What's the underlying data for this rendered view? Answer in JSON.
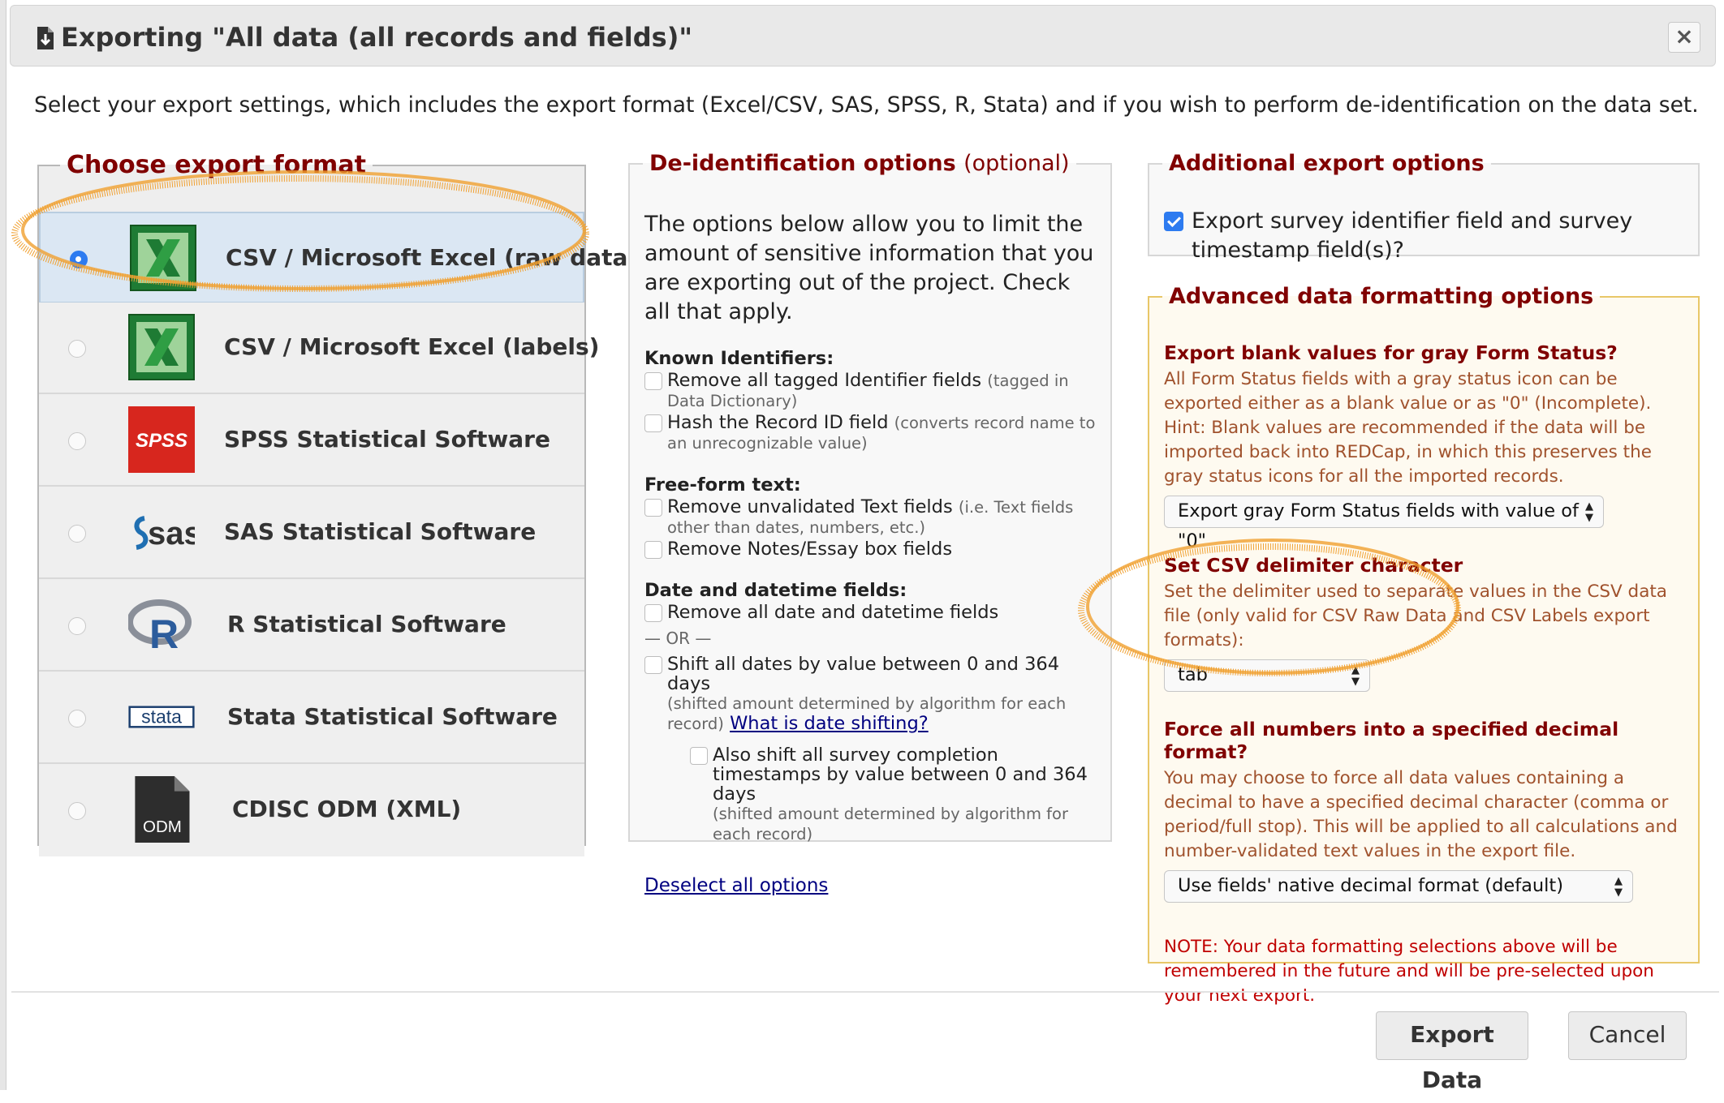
{
  "dialog": {
    "title": "Exporting \"All data (all records and fields)\"",
    "close_label": "×",
    "intro": "Select your export settings, which includes the export format (Excel/CSV, SAS, SPSS, R, Stata) and if you wish to perform de-identification on the data set."
  },
  "format_panel": {
    "legend": "Choose export format",
    "selected_index": 0,
    "formats": [
      {
        "label": "CSV / Microsoft Excel (raw data)",
        "icon": "excel-icon"
      },
      {
        "label": "CSV / Microsoft Excel (labels)",
        "icon": "excel-icon"
      },
      {
        "label": "SPSS Statistical Software",
        "icon": "spss-icon"
      },
      {
        "label": "SAS Statistical Software",
        "icon": "sas-icon"
      },
      {
        "label": "R Statistical Software",
        "icon": "r-icon"
      },
      {
        "label": "Stata Statistical Software",
        "icon": "stata-icon"
      },
      {
        "label": "CDISC ODM (XML)",
        "icon": "odm-file-icon"
      }
    ],
    "icon_text": {
      "spss": "SPSS",
      "sas": "sas",
      "r": "R",
      "stata": "stata",
      "odm": "ODM"
    }
  },
  "deid": {
    "legend": "De-identification options",
    "legend_optional": "(optional)",
    "description": "The options below allow you to limit the amount of sensitive information that you are exporting out of the project. Check all that apply.",
    "known_title": "Known Identifiers:",
    "remove_tagged": "Remove all tagged Identifier fields",
    "remove_tagged_note": "(tagged in Data Dictionary)",
    "hash_record": "Hash the Record ID field",
    "hash_record_note": "(converts record name to an unrecognizable value)",
    "freeform_title": "Free-form text:",
    "remove_text": "Remove unvalidated Text fields",
    "remove_text_note": "(i.e. Text fields other than dates, numbers, etc.)",
    "remove_notes": "Remove Notes/Essay box fields",
    "date_title": "Date and datetime fields:",
    "remove_dates": "Remove all date and datetime fields",
    "or_label": "— OR —",
    "shift_dates": "Shift all dates by value between 0 and 364 days",
    "shift_dates_note": "(shifted amount determined by algorithm for each record)",
    "date_shift_link": "What is date shifting?",
    "shift_survey": "Also shift all survey completion timestamps by value between 0 and 364 days",
    "shift_survey_note": "(shifted amount determined by algorithm for each record)",
    "deselect_link": "Deselect all options"
  },
  "additional": {
    "legend": "Additional export options",
    "survey_fields_label": "Export survey identifier field and survey timestamp field(s)?",
    "survey_fields_checked": true
  },
  "advanced": {
    "legend": "Advanced data formatting options",
    "blank_title": "Export blank values for gray Form Status?",
    "blank_desc": "All Form Status fields with a gray status icon can be exported either as a blank value or as \"0\" (Incomplete). Hint: Blank values are recommended if the data will be imported back into REDCap, in which this preserves the gray status icons for all the imported records.",
    "blank_select": "Export gray Form Status fields with value of \"0\"",
    "delim_title": "Set CSV delimiter character",
    "delim_desc": "Set the delimiter used to separate values in the CSV data file (only valid for CSV Raw Data and CSV Labels export formats):",
    "delim_select": "tab",
    "decimal_title": "Force all numbers into a specified decimal format?",
    "decimal_desc": "You may choose to force all data values containing a decimal to have a specified decimal character (comma or period/full stop). This will be applied to all calculations and number-validated text values in the export file.",
    "decimal_select": "Use fields' native decimal format (default)",
    "note": "NOTE: Your data formatting selections above will be remembered in the future and will be pre-selected upon your next export."
  },
  "footer": {
    "export_label": "Export Data",
    "cancel_label": "Cancel"
  },
  "colors": {
    "legend_red": "#800000",
    "radio_blue": "#2d7bf0",
    "highlight_orange": "#f0a030",
    "excel_green": "#2e7d32",
    "spss_red": "#d7261e"
  }
}
